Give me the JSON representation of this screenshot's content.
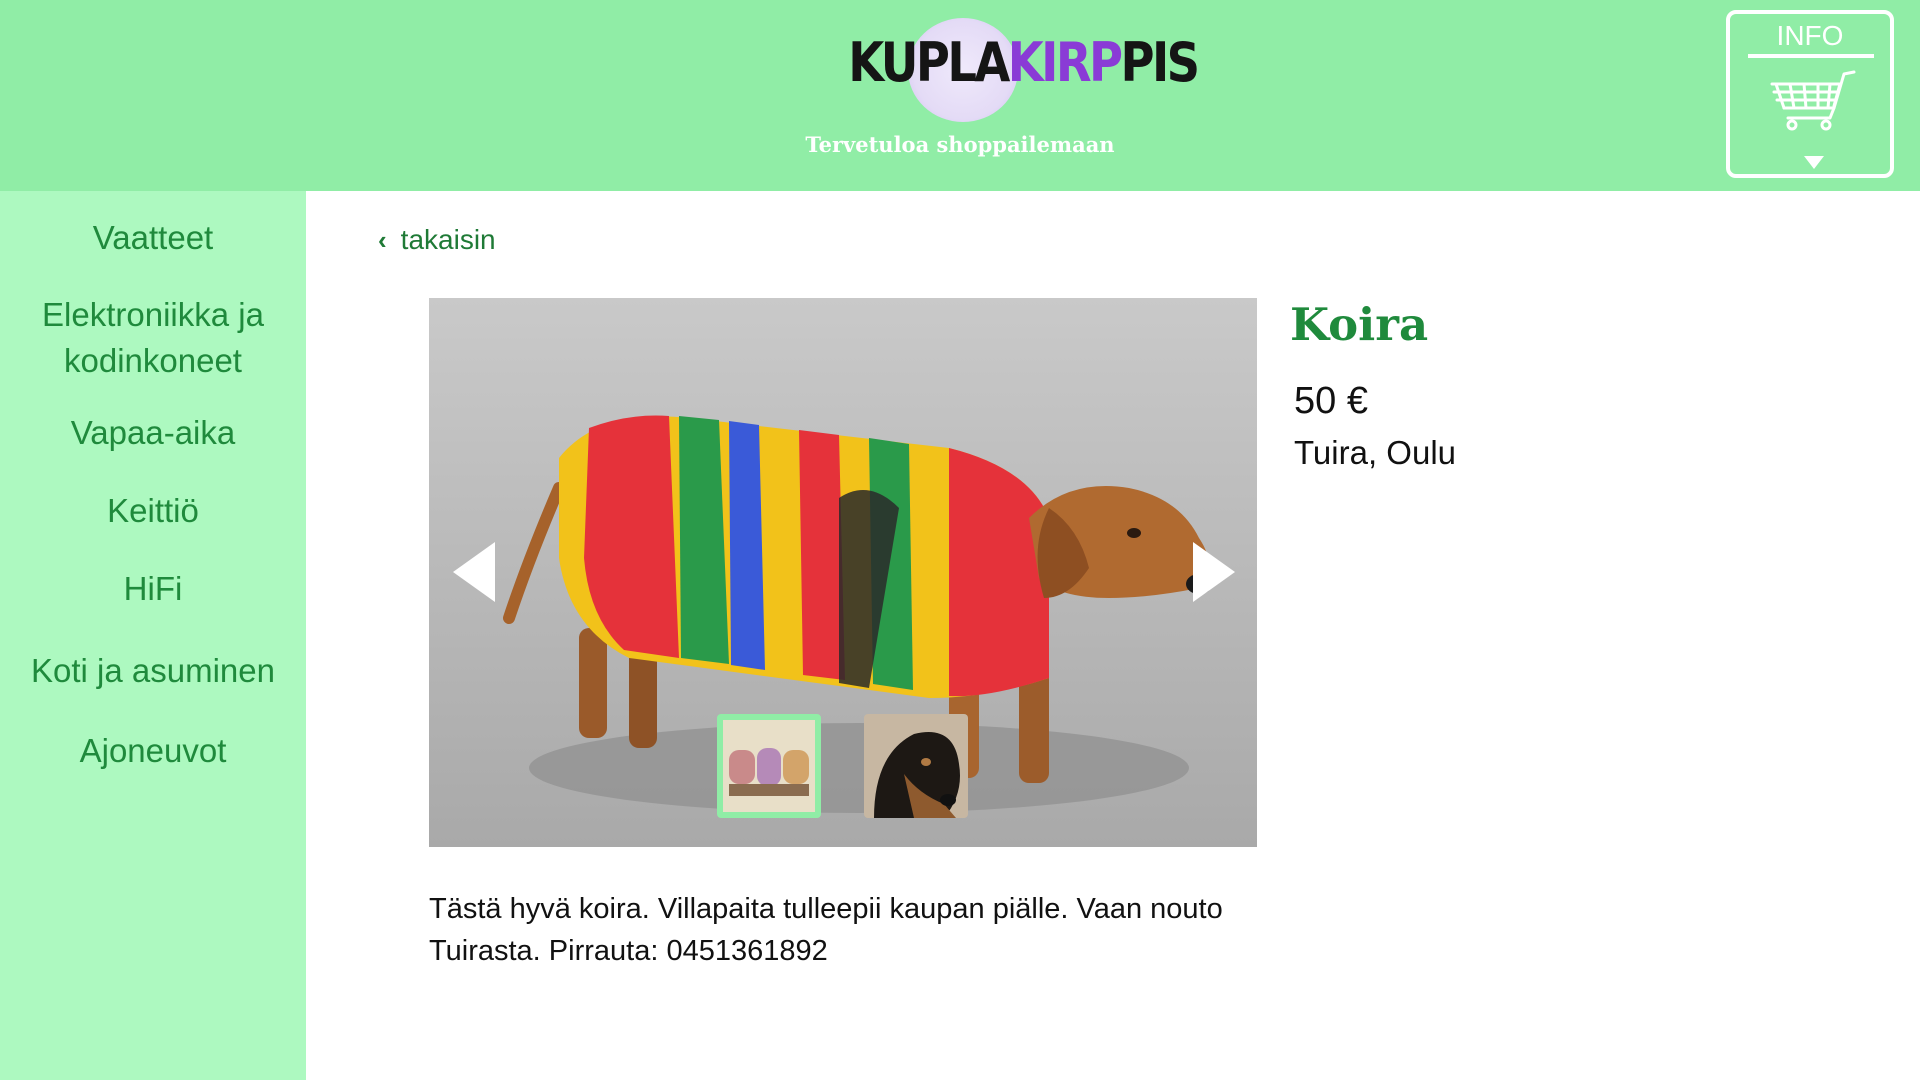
{
  "header": {
    "logo": {
      "part1": "KUPLA",
      "part2": "KIRP",
      "part3": "PIS"
    },
    "tagline": "Tervetuloa shoppailemaan",
    "info_label": "INFO",
    "info_icon": "shopping-cart-icon"
  },
  "sidebar": {
    "items": [
      {
        "label": "Vaatteet"
      },
      {
        "label": "Elektroniikka ja kodinkoneet"
      },
      {
        "label": "Vapaa-aika"
      },
      {
        "label": "Keittiö"
      },
      {
        "label": "HiFi"
      },
      {
        "label": "Koti ja asuminen"
      },
      {
        "label": "Ajoneuvot"
      }
    ]
  },
  "main": {
    "back_label": "takaisin",
    "gallery": {
      "thumbnails": [
        "dog-in-sweater-thumbnail",
        "dachshund-head-thumbnail"
      ],
      "selected_index": 0
    },
    "product": {
      "title": "Koira",
      "price": "50 €",
      "location": "Tuira, Oulu",
      "description": "Tästä hyvä koira. Villapaita tulleepii kaupan piälle. Vaan nouto Tuirasta. Pirrauta: 0451361892"
    }
  },
  "colors": {
    "header_bg": "#90eda6",
    "sidebar_bg": "#adf9c0",
    "accent_green": "#1f8a3c",
    "logo_purple": "#8a3bd6"
  }
}
